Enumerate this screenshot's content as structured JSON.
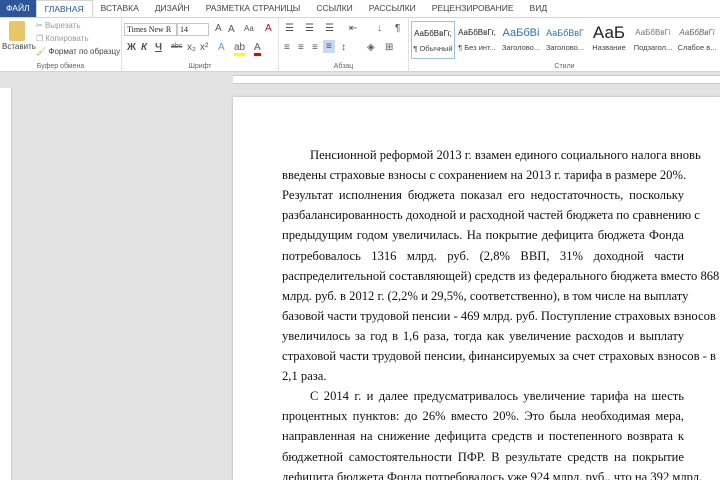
{
  "tabs": [
    "ФАЙЛ",
    "ГЛАВНАЯ",
    "ВСТАВКА",
    "ДИЗАЙН",
    "РАЗМЕТКА СТРАНИЦЫ",
    "ССЫЛКИ",
    "РАССЫЛКИ",
    "РЕЦЕНЗИРОВАНИЕ",
    "ВИД"
  ],
  "clipboard": {
    "paste": "Вставить",
    "cut": "Вырезать",
    "copy": "Копировать",
    "format_painter": "Формат по образцу",
    "label": "Буфер обмена"
  },
  "font": {
    "name": "Times New R",
    "size": "14",
    "label": "Шрифт",
    "bold": "Ж",
    "italic": "К",
    "underline": "Ч",
    "strike": "abc",
    "case": "Aa"
  },
  "paragraph": {
    "label": "Абзац"
  },
  "styles": {
    "label": "Стили",
    "items": [
      {
        "preview": "АаБбВвГг,",
        "name": "¶ Обычный"
      },
      {
        "preview": "АаБбВвГг,",
        "name": "¶ Без инт..."
      },
      {
        "preview": "АаБбВі",
        "name": "Заголово..."
      },
      {
        "preview": "АаБбВвГ",
        "name": "Заголово..."
      },
      {
        "preview": "АаБ",
        "name": "Название"
      },
      {
        "preview": "АаБбВвГі",
        "name": "Подзагол..."
      },
      {
        "preview": "АаБбВвГі",
        "name": "Слабое в..."
      }
    ]
  },
  "document": {
    "lines": [
      "Пенсионной реформой 2013 г. взамен единого социального налога вновь",
      "введены страховые взносы с сохранением на 2013 г. тарифа в размере 20%.",
      "Результат исполнения бюджета показал его недостаточность, поскольку",
      "разбалансированность доходной и расходной частей бюджета по сравнению с",
      "предыдущим годом увеличилась. На покрытие дефицита бюджета Фонда",
      "потребовалось 1316 млрд. руб. (2,8% ВВП, 31% доходной части",
      "распределительной составляющей) средств из федерального бюджета вместо 868",
      "млрд. руб. в 2012 г. (2,2% и 29,5%, соответственно), в том числе на выплату",
      "базовой части трудовой пенсии - 469 млрд. руб. Поступление страховых взносов",
      "увеличилось за год в 1,6 раза, тогда как увеличение расходов и выплату",
      "страховой части трудовой пенсии, финансируемых за счет страховых взносов - в",
      "2,1 раза.",
      "С 2014 г. и далее предусматривалось увеличение тарифа на шесть",
      "процентных пунктов: до 26% вместо 20%. Это была необходимая мера,",
      "направленная на снижение дефицита средств и постепенного возврата к",
      "бюджетной самостоятельности ПФР. В результате средств на покрытие",
      "дефицита бюджета Фонда потребовалось уже 924 млрд. руб., что на 392 млрд."
    ]
  }
}
